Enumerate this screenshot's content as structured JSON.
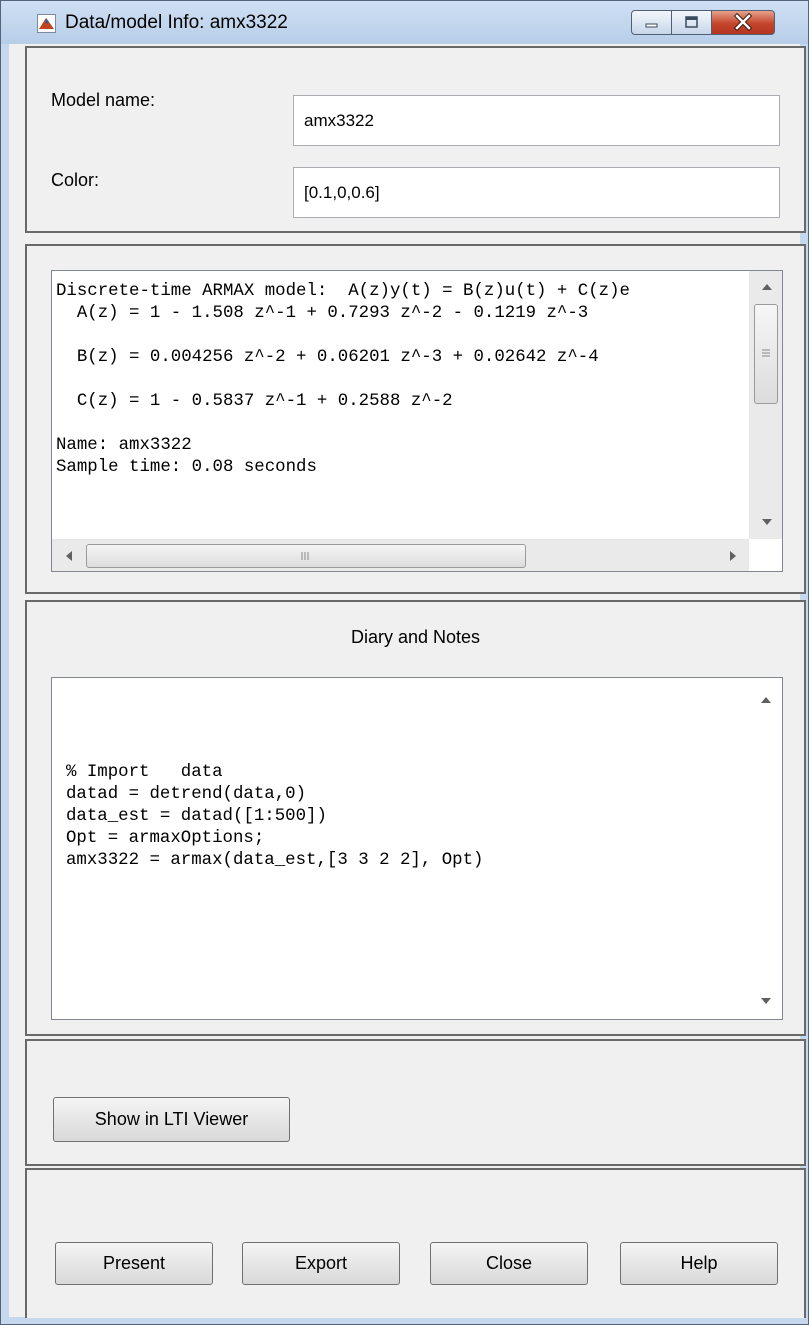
{
  "window": {
    "title": "Data/model Info: amx3322",
    "controls": [
      "minimize-icon",
      "maximize-icon",
      "close-icon"
    ]
  },
  "model_info": {
    "model_name_label": "Model name:",
    "model_name_value": "amx3322",
    "color_label": "Color:",
    "color_value": "[0.1,0,0.6]"
  },
  "model_text": {
    "lines": [
      "Discrete-time ARMAX model:  A(z)y(t) = B(z)u(t) + C(z)e",
      "  A(z) = 1 - 1.508 z^-1 + 0.7293 z^-2 - 0.1219 z^-3",
      "",
      "  B(z) = 0.004256 z^-2 + 0.06201 z^-3 + 0.02642 z^-4",
      "",
      "  C(z) = 1 - 0.5837 z^-1 + 0.2588 z^-2",
      "",
      "Name: amx3322",
      "Sample time: 0.08 seconds"
    ]
  },
  "diary": {
    "heading": "Diary and Notes",
    "lines": [
      "% Import   data",
      "datad = detrend(data,0)",
      "data_est = datad([1:500])",
      "Opt = armaxOptions;",
      "amx3322 = armax(data_est,[3 3 2 2], Opt)"
    ]
  },
  "actions": {
    "show_lti_viewer": "Show in LTI Viewer"
  },
  "footer": {
    "present": "Present",
    "export": "Export",
    "close": "Close",
    "help": "Help"
  }
}
